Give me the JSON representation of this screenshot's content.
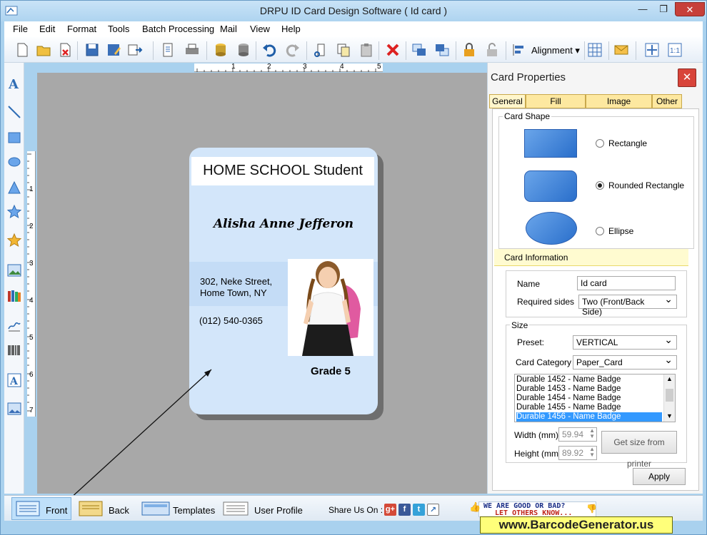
{
  "window": {
    "title": "DRPU ID Card Design Software ( Id card )"
  },
  "menu": [
    "File",
    "Edit",
    "Format",
    "Tools",
    "Batch Processing",
    "Mail",
    "View",
    "Help"
  ],
  "toolbar": {
    "alignment_label": "Alignment"
  },
  "ruler": {
    "h": [
      "1",
      "2",
      "3",
      "4",
      "5"
    ],
    "v": [
      "1",
      "2",
      "3",
      "4",
      "5",
      "6",
      "7"
    ]
  },
  "card": {
    "title": "HOME SCHOOL Student",
    "name": "Alisha Anne Jefferon",
    "address_line1": "302, Neke Street,",
    "address_line2": "Home Town, NY",
    "phone": "(012) 540-0365",
    "grade": "Grade 5"
  },
  "panel": {
    "title": "Card Properties",
    "tabs": [
      "General",
      "Fill Background",
      "Image Processing",
      "Other"
    ],
    "card_shape": {
      "label": "Card Shape",
      "options": [
        {
          "label": "Rectangle",
          "selected": false
        },
        {
          "label": "Rounded Rectangle",
          "selected": true
        },
        {
          "label": "Ellipse",
          "selected": false
        }
      ]
    },
    "card_information": {
      "label": "Card Information",
      "name_label": "Name",
      "name_value": "Id card",
      "required_sides_label": "Required sides",
      "required_sides_value": "Two (Front/Back Side)"
    },
    "size": {
      "label": "Size",
      "preset_label": "Preset:",
      "preset_value": "VERTICAL",
      "category_label": "Card Category",
      "category_value": "Paper_Card",
      "list": [
        "Durable 1452 - Name Badge",
        "Durable 1453 - Name Badge",
        "Durable 1454 - Name Badge",
        "Durable 1455 - Name Badge",
        "Durable 1456 - Name Badge"
      ],
      "selected_index": 4,
      "width_label": "Width  (mm)",
      "width_value": "59.94",
      "height_label": "Height  (mm)",
      "height_value": "89.92",
      "get_size_button": "Get size from printer"
    },
    "apply_button": "Apply"
  },
  "bottombar": {
    "front": "Front",
    "back": "Back",
    "templates": "Templates",
    "user_profile": "User Profile",
    "share_label": "Share Us On :",
    "feedback_line1": "WE ARE GOOD OR BAD?",
    "feedback_line2": "LET OTHERS KNOW..."
  },
  "watermark": "www.BarcodeGenerator.us",
  "colors": {
    "accent": "#3399ff",
    "card_bg": "#d3e6fa",
    "canvas": "#a8a8a8",
    "close_red": "#d8443a"
  }
}
